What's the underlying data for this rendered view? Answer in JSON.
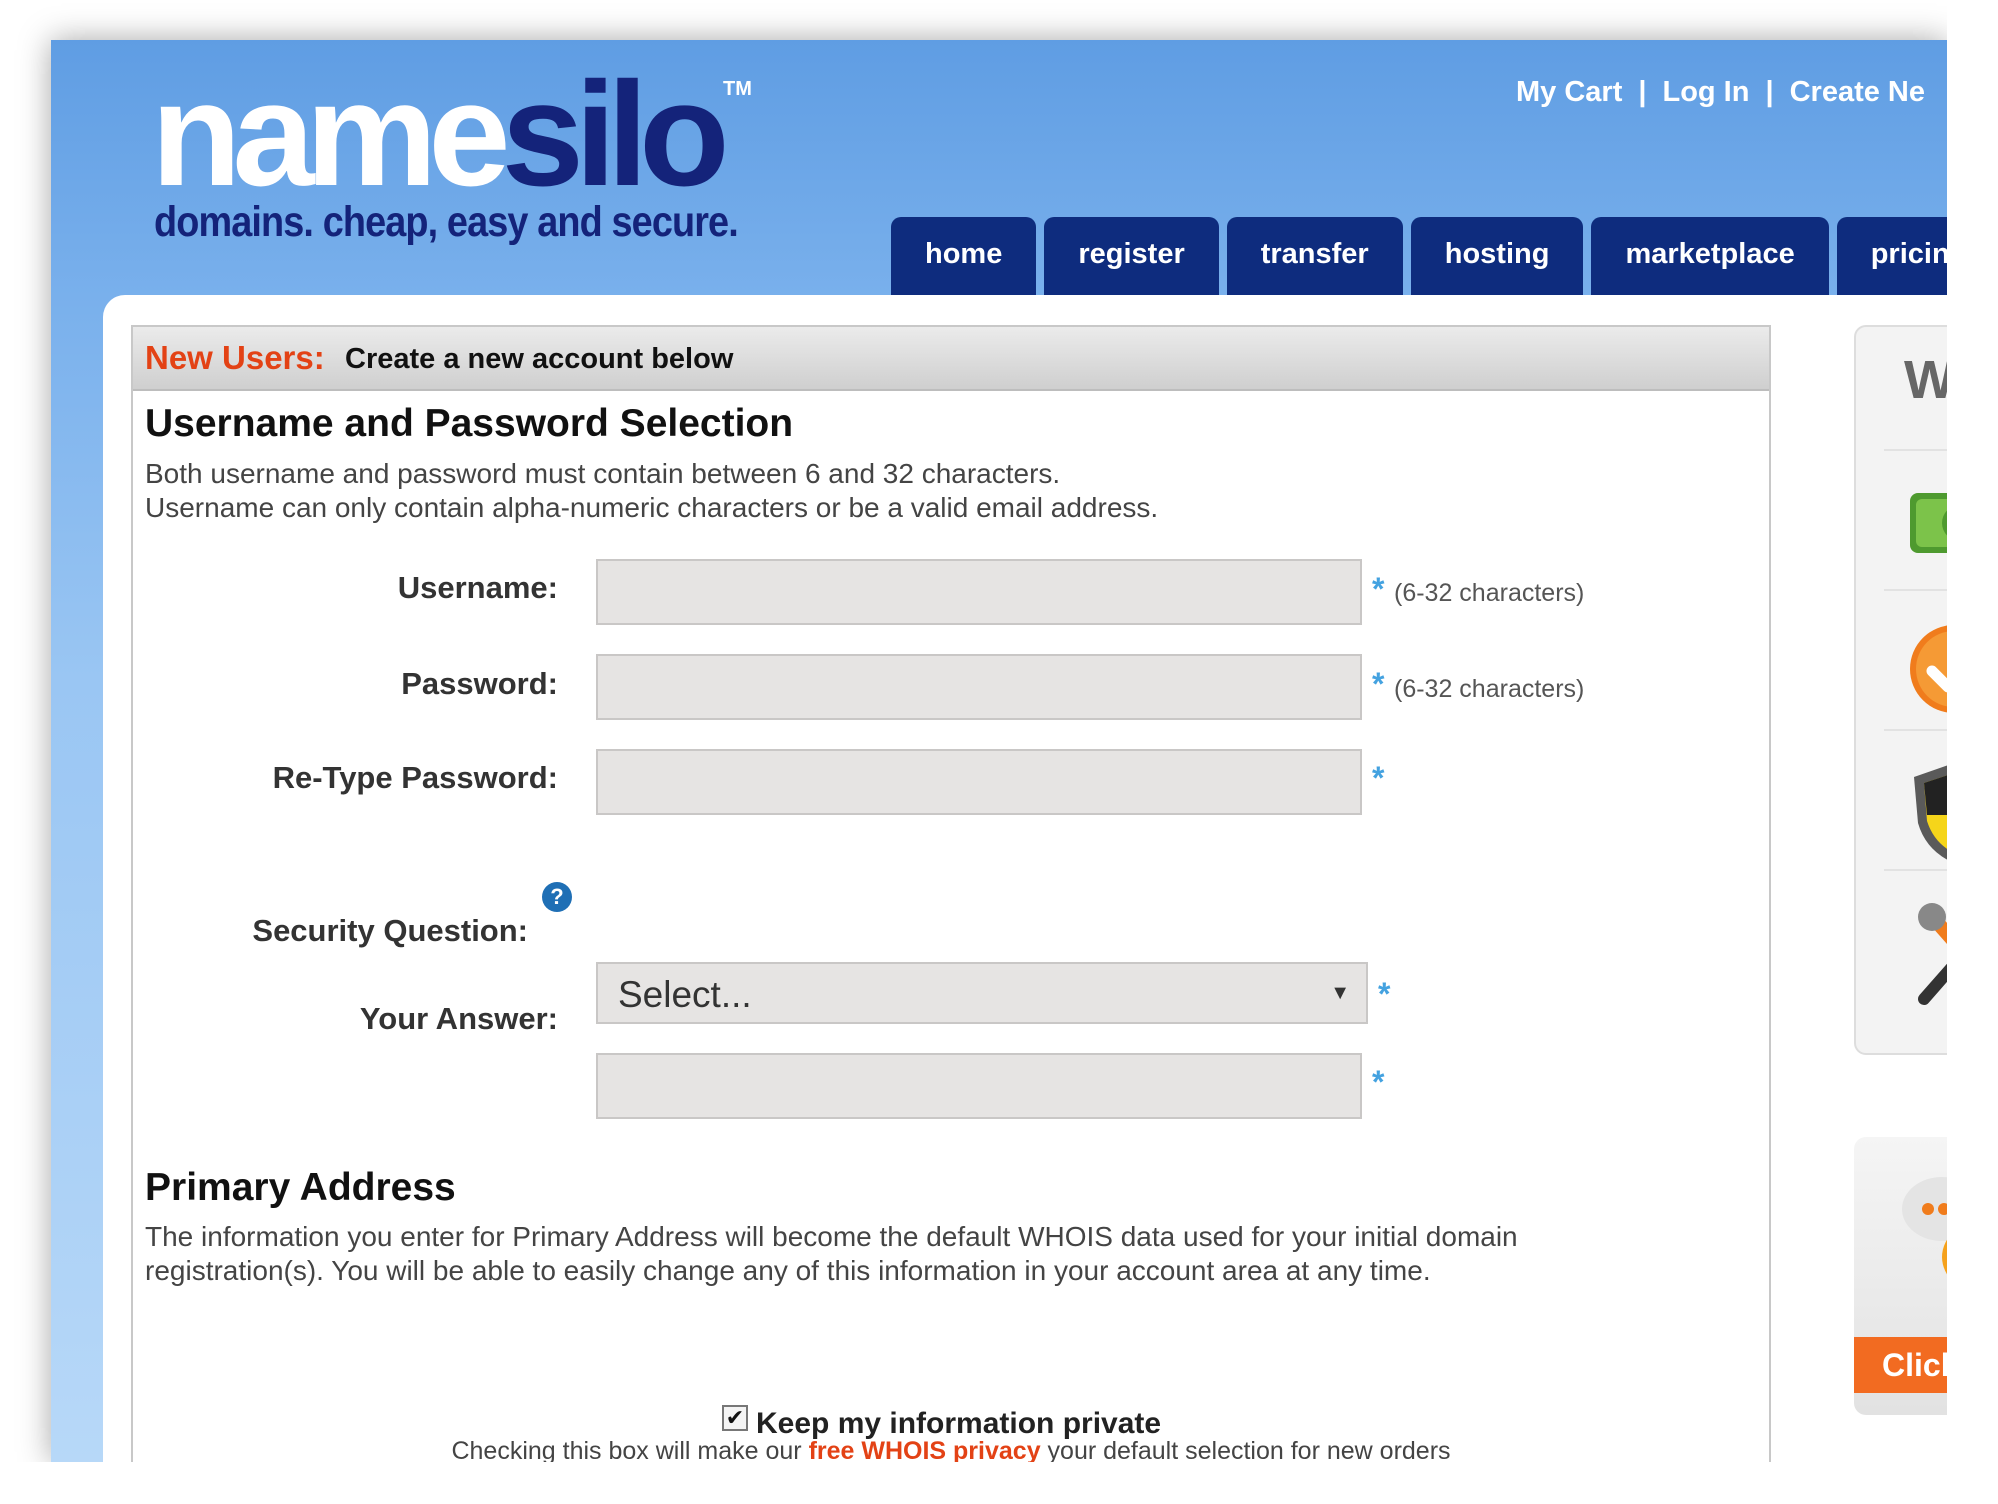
{
  "brand": {
    "logo_name": "name",
    "logo_silo": "silo",
    "trademark": "TM",
    "tagline": "domains. cheap, easy and secure."
  },
  "top_links": {
    "my_cart": "My Cart",
    "separator": "|",
    "log_in": "Log In",
    "create_new": "Create Ne"
  },
  "nav_tabs": [
    "home",
    "register",
    "transfer",
    "hosting",
    "marketplace",
    "pricing"
  ],
  "form": {
    "header_label": "New Users:",
    "header_text": "Create a new account below",
    "section1_title": "Username and Password Selection",
    "section1_desc_line1": "Both username and password must contain between 6 and 32 characters.",
    "section1_desc_line2": "Username can only contain alpha-numeric characters or be a valid email address.",
    "username_label": "Username:",
    "password_label": "Password:",
    "retype_label": "Re-Type Password:",
    "security_label": "Security Question:",
    "answer_label": "Your Answer:",
    "required_mark": "*",
    "length_hint": "(6-32 characters)",
    "help_icon": "?",
    "security_value": "Select...",
    "select_caret": "▼",
    "section2_title": "Primary Address",
    "section2_desc_line1": "The information you enter for Primary Address will become the default WHOIS data used for your initial domain",
    "section2_desc_line2": "registration(s). You will be able to easily change any of this information in your account area at any time.",
    "privacy_checked_mark": "✔",
    "privacy_label": "Keep my information private",
    "privacy_note_before": "Checking this box will make our ",
    "privacy_link": "free WHOIS privacy",
    "privacy_note_after": " your default selection for new orders"
  },
  "sidebar": {
    "why_title": "Why",
    "icons": [
      "money-icon",
      "checkmark-icon",
      "shield-icon",
      "tools-icon"
    ],
    "promo_button": "Click he"
  },
  "colors": {
    "brand_navy": "#14237a",
    "tab_navy": "#0e2c7e",
    "accent_orange": "#e34215",
    "required_blue": "#44a2e0"
  }
}
